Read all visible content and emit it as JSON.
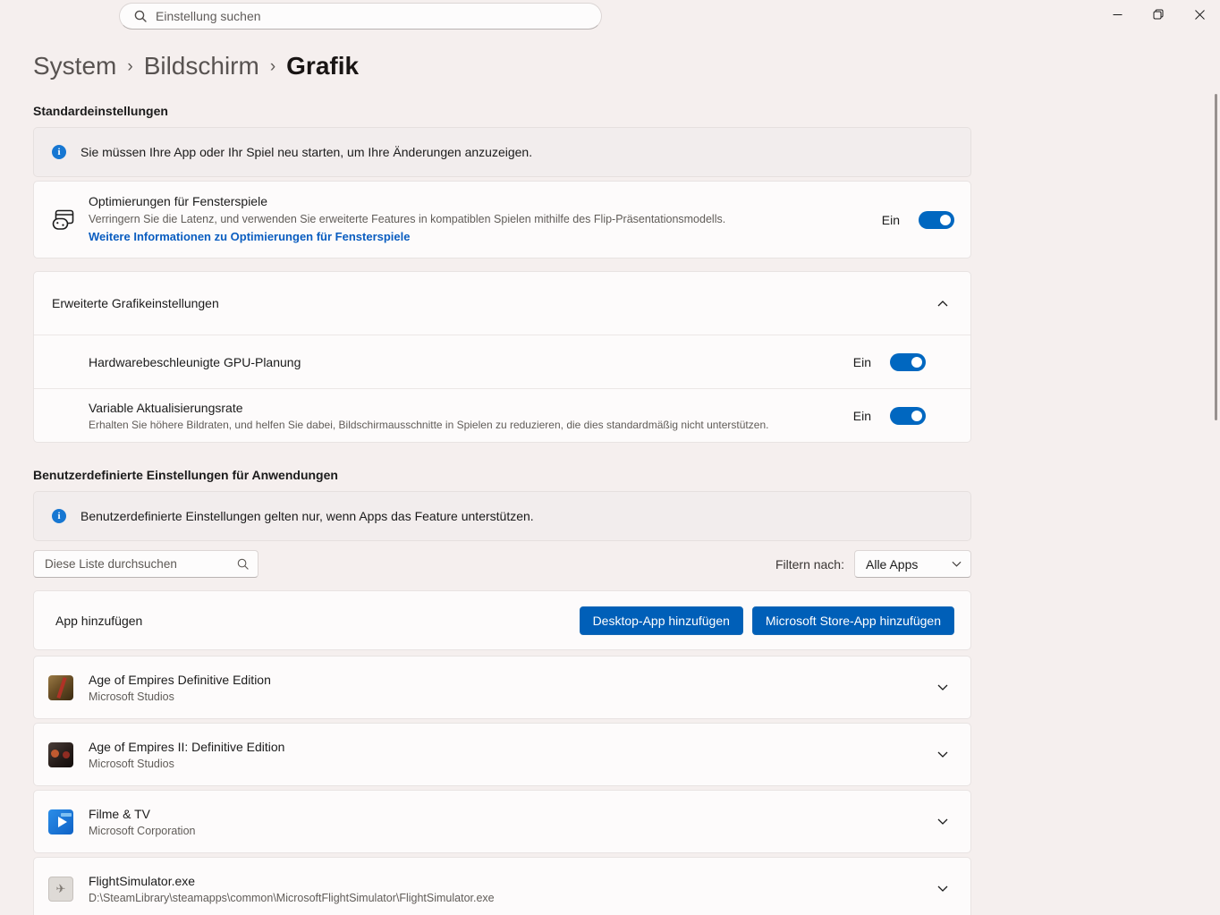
{
  "titlebar": {
    "search_placeholder": "Einstellung suchen"
  },
  "breadcrumb": {
    "items": [
      "System",
      "Bildschirm",
      "Grafik"
    ],
    "separator": "›"
  },
  "default_section": {
    "title": "Standardeinstellungen",
    "info": "Sie müssen Ihre App oder Ihr Spiel neu starten, um Ihre Änderungen anzuzeigen.",
    "game_card": {
      "title": "Optimierungen für Fensterspiele",
      "description": "Verringern Sie die Latenz, und verwenden Sie erweiterte Features in kompatiblen Spielen mithilfe des Flip-Präsentationsmodells.",
      "link": "Weitere Informationen zu Optimierungen für Fensterspiele",
      "state": "Ein"
    },
    "expander": {
      "title": "Erweiterte Grafikeinstellungen",
      "rows": [
        {
          "title": "Hardwarebeschleunigte GPU-Planung",
          "state": "Ein"
        },
        {
          "title": "Variable Aktualisierungsrate",
          "description": "Erhalten Sie höhere Bildraten, und helfen Sie dabei, Bildschirmausschnitte in Spielen zu reduzieren, die dies standardmäßig nicht unterstützen.",
          "state": "Ein"
        }
      ]
    }
  },
  "custom_section": {
    "title": "Benutzerdefinierte Einstellungen für Anwendungen",
    "info": "Benutzerdefinierte Einstellungen gelten nur, wenn Apps das Feature unterstützen.",
    "list_search_placeholder": "Diese Liste durchsuchen",
    "filter_label": "Filtern nach:",
    "filter_value": "Alle Apps",
    "add_app": {
      "label": "App hinzufügen",
      "desktop_button": "Desktop-App hinzufügen",
      "store_button": "Microsoft Store-App hinzufügen"
    },
    "apps": [
      {
        "name": "Age of Empires Definitive Edition",
        "publisher": "Microsoft Studios"
      },
      {
        "name": "Age of Empires II: Definitive Edition",
        "publisher": "Microsoft Studios"
      },
      {
        "name": "Filme & TV",
        "publisher": "Microsoft Corporation"
      },
      {
        "name": "FlightSimulator.exe",
        "publisher": "D:\\SteamLibrary\\steamapps\\common\\MicrosoftFlightSimulator\\FlightSimulator.exe"
      }
    ]
  },
  "colors": {
    "accent_toggle": "#0067c0",
    "accent_button": "#005fb8",
    "link": "#0a5dc0",
    "info_icon": "#1777d2",
    "background": "#f5efee"
  }
}
